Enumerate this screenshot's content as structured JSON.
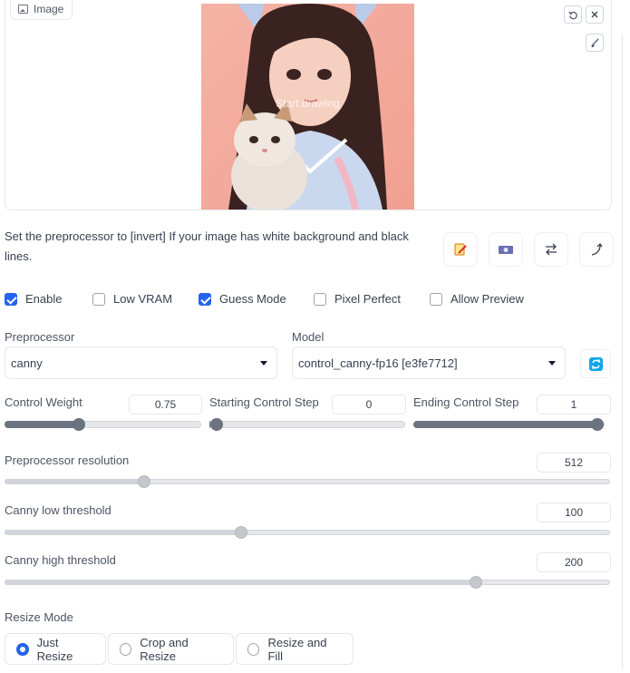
{
  "image_panel": {
    "label": "Image",
    "overlay_text": "Start drawing",
    "photo_icon": "photo-icon",
    "reset_icon": "undo-icon",
    "close_icon": "close-icon",
    "brush_icon": "brush-icon"
  },
  "hint_text": "Set the preprocessor to [invert] If your image has white background and black lines.",
  "tool_icons": [
    "edit-icon",
    "camera-icon",
    "swap-icon",
    "curve-arrow-icon"
  ],
  "checkboxes": [
    {
      "label": "Enable",
      "checked": true
    },
    {
      "label": "Low VRAM",
      "checked": false
    },
    {
      "label": "Guess Mode",
      "checked": true
    },
    {
      "label": "Pixel Perfect",
      "checked": false
    },
    {
      "label": "Allow Preview",
      "checked": false
    }
  ],
  "preprocessor": {
    "label": "Preprocessor",
    "value": "canny"
  },
  "model": {
    "label": "Model",
    "value": "control_canny-fp16 [e3fe7712]",
    "refresh_icon": "refresh-icon"
  },
  "control_weight": {
    "label": "Control Weight",
    "value": "0.75",
    "fraction": 0.375
  },
  "starting_step": {
    "label": "Starting Control Step",
    "value": "0",
    "fraction": 0
  },
  "ending_step": {
    "label": "Ending Control Step",
    "value": "1",
    "fraction": 1
  },
  "preprocessor_resolution": {
    "label": "Preprocessor resolution",
    "value": "512",
    "fraction": 0.23
  },
  "canny_low": {
    "label": "Canny low threshold",
    "value": "100",
    "fraction": 0.39
  },
  "canny_high": {
    "label": "Canny high threshold",
    "value": "200",
    "fraction": 0.78
  },
  "resize_mode": {
    "label": "Resize Mode",
    "options": [
      "Just Resize",
      "Crop and Resize",
      "Resize and Fill"
    ],
    "selected": "Just Resize"
  },
  "colors": {
    "accent": "#2563eb",
    "refresh": "#0ea5e9",
    "slider": "#6b7280"
  }
}
